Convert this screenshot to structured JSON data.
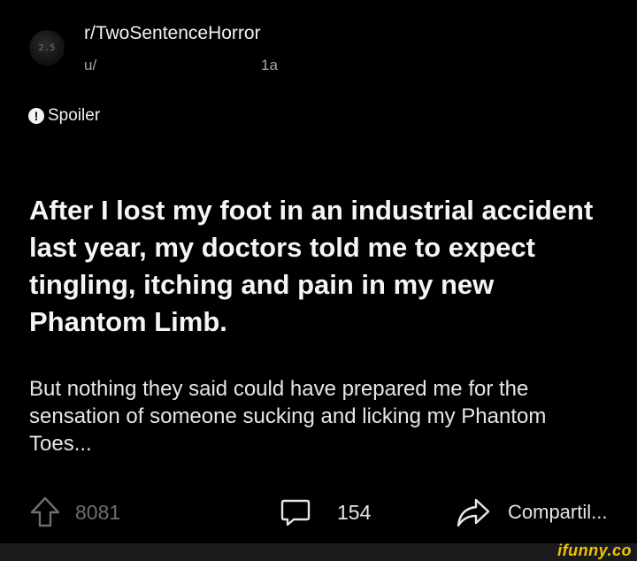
{
  "post": {
    "subreddit": "r/TwoSentenceHorror",
    "username": "u/",
    "age": "1a",
    "avatar_text": "2.5",
    "spoiler_label": "Spoiler",
    "title": "After I lost my foot in an industrial accident last year, my doctors told me to expect tingling, itching and pain in my new Phantom Limb.",
    "body": "But nothing they said could have prepared me for the sensation of someone sucking and licking my Phantom Toes..."
  },
  "actions": {
    "upvotes": "8081",
    "comments": "154",
    "share_label": "Compartil..."
  },
  "icons": {
    "spoiler": "exclamation-circle-icon",
    "upvote": "arrow-up-icon",
    "comment": "speech-bubble-icon",
    "share": "share-arrow-icon"
  },
  "watermark": "ifunny.co",
  "colors": {
    "background": "#000000",
    "text": "#f5f5f5",
    "muted": "#a6a6a6",
    "watermark": "#f2c400"
  }
}
